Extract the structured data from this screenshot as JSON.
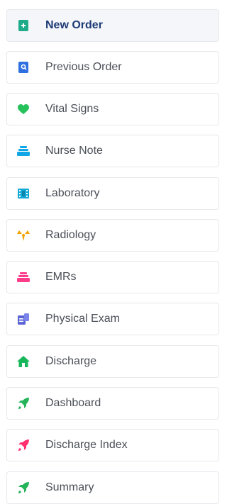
{
  "menu": {
    "items": [
      {
        "label": "New Order",
        "icon": "new-order-icon",
        "color": "#1fab89",
        "active": true
      },
      {
        "label": "Previous Order",
        "icon": "previous-order-icon",
        "color": "#2f6fe0",
        "active": false
      },
      {
        "label": "Vital Signs",
        "icon": "heart-icon",
        "color": "#25c25c",
        "active": false
      },
      {
        "label": "Nurse Note",
        "icon": "nurse-note-icon",
        "color": "#11a6e6",
        "active": false
      },
      {
        "label": "Laboratory",
        "icon": "laboratory-icon",
        "color": "#13a9d6",
        "active": false
      },
      {
        "label": "Radiology",
        "icon": "radiation-icon",
        "color": "#f4a100",
        "active": false
      },
      {
        "label": "EMRs",
        "icon": "emrs-icon",
        "color": "#ff3d8b",
        "active": false
      },
      {
        "label": "Physical Exam",
        "icon": "physical-exam-icon",
        "color": "#5a63d6",
        "active": false
      },
      {
        "label": "Discharge",
        "icon": "home-icon",
        "color": "#18b65b",
        "active": false
      },
      {
        "label": "Dashboard",
        "icon": "rocket-icon",
        "color": "#25b35a",
        "active": false
      },
      {
        "label": "Discharge Index",
        "icon": "rocket-icon",
        "color": "#ff2f6d",
        "active": false
      },
      {
        "label": "Summary",
        "icon": "rocket-icon",
        "color": "#25b35a",
        "active": false
      }
    ]
  }
}
